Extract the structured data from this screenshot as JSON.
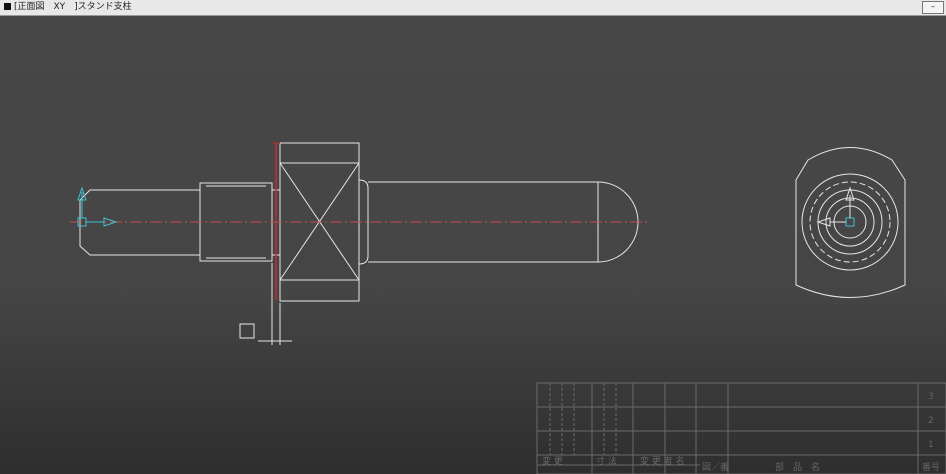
{
  "window": {
    "title": "[正面図　XY　]スタンド支柱",
    "minimize_label": "–"
  },
  "title_block": {
    "row_numbers": [
      "3",
      "2",
      "1"
    ],
    "headers": [
      "変 更",
      "寸 法",
      "変 更 者 名",
      "図／番",
      "部　品　名",
      "番号"
    ]
  },
  "colors": {
    "background": "#454545",
    "lines": "#e6e6e6",
    "centerline": "#c05050",
    "highlight": "#b03030",
    "axis": "#40c0d0"
  }
}
